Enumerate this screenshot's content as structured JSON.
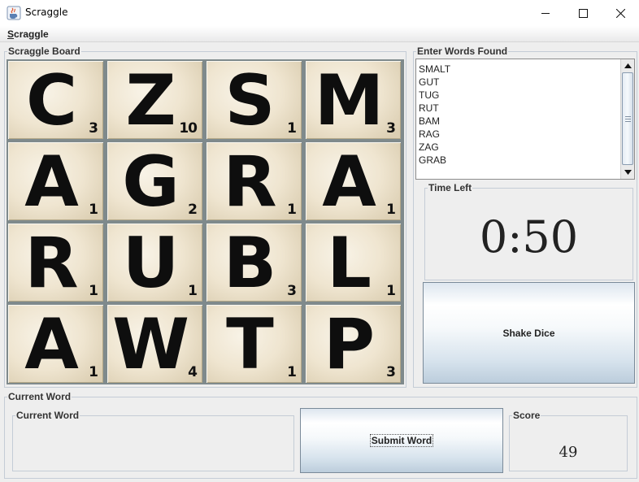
{
  "window": {
    "title": "Scraggle",
    "icons": {
      "app": "java-coffee-cup-icon",
      "minimize": "minimize-icon",
      "maximize": "maximize-icon",
      "close": "close-icon"
    }
  },
  "menu": {
    "mnemonic": "S",
    "rest": "craggle"
  },
  "board": {
    "title": "Scraggle Board",
    "tiles": [
      {
        "letter": "C",
        "points": "3"
      },
      {
        "letter": "Z",
        "points": "10"
      },
      {
        "letter": "S",
        "points": "1"
      },
      {
        "letter": "M",
        "points": "3"
      },
      {
        "letter": "A",
        "points": "1"
      },
      {
        "letter": "G",
        "points": "2"
      },
      {
        "letter": "R",
        "points": "1"
      },
      {
        "letter": "A",
        "points": "1"
      },
      {
        "letter": "R",
        "points": "1"
      },
      {
        "letter": "U",
        "points": "1"
      },
      {
        "letter": "B",
        "points": "3"
      },
      {
        "letter": "L",
        "points": "1"
      },
      {
        "letter": "A",
        "points": "1"
      },
      {
        "letter": "W",
        "points": "4"
      },
      {
        "letter": "T",
        "points": "1"
      },
      {
        "letter": "P",
        "points": "3"
      }
    ]
  },
  "words": {
    "title": "Enter Words Found",
    "list": [
      "SMALT",
      "GUT",
      "TUG",
      "RUT",
      "BAM",
      "RAG",
      "ZAG",
      "GRAB"
    ]
  },
  "timer": {
    "title": "Time Left",
    "value": "0:50"
  },
  "shake_button": "Shake Dice",
  "current_word": {
    "outer_title": "Current Word",
    "inner_title": "Current Word",
    "value": ""
  },
  "submit_button": "Submit Word",
  "score": {
    "title": "Score",
    "value": "49"
  },
  "colors": {
    "tile_face": "#f3ecdc",
    "grid_gap": "#7f8a8c",
    "panel_bg": "#eeeeee",
    "border": "#c4ccd6"
  }
}
